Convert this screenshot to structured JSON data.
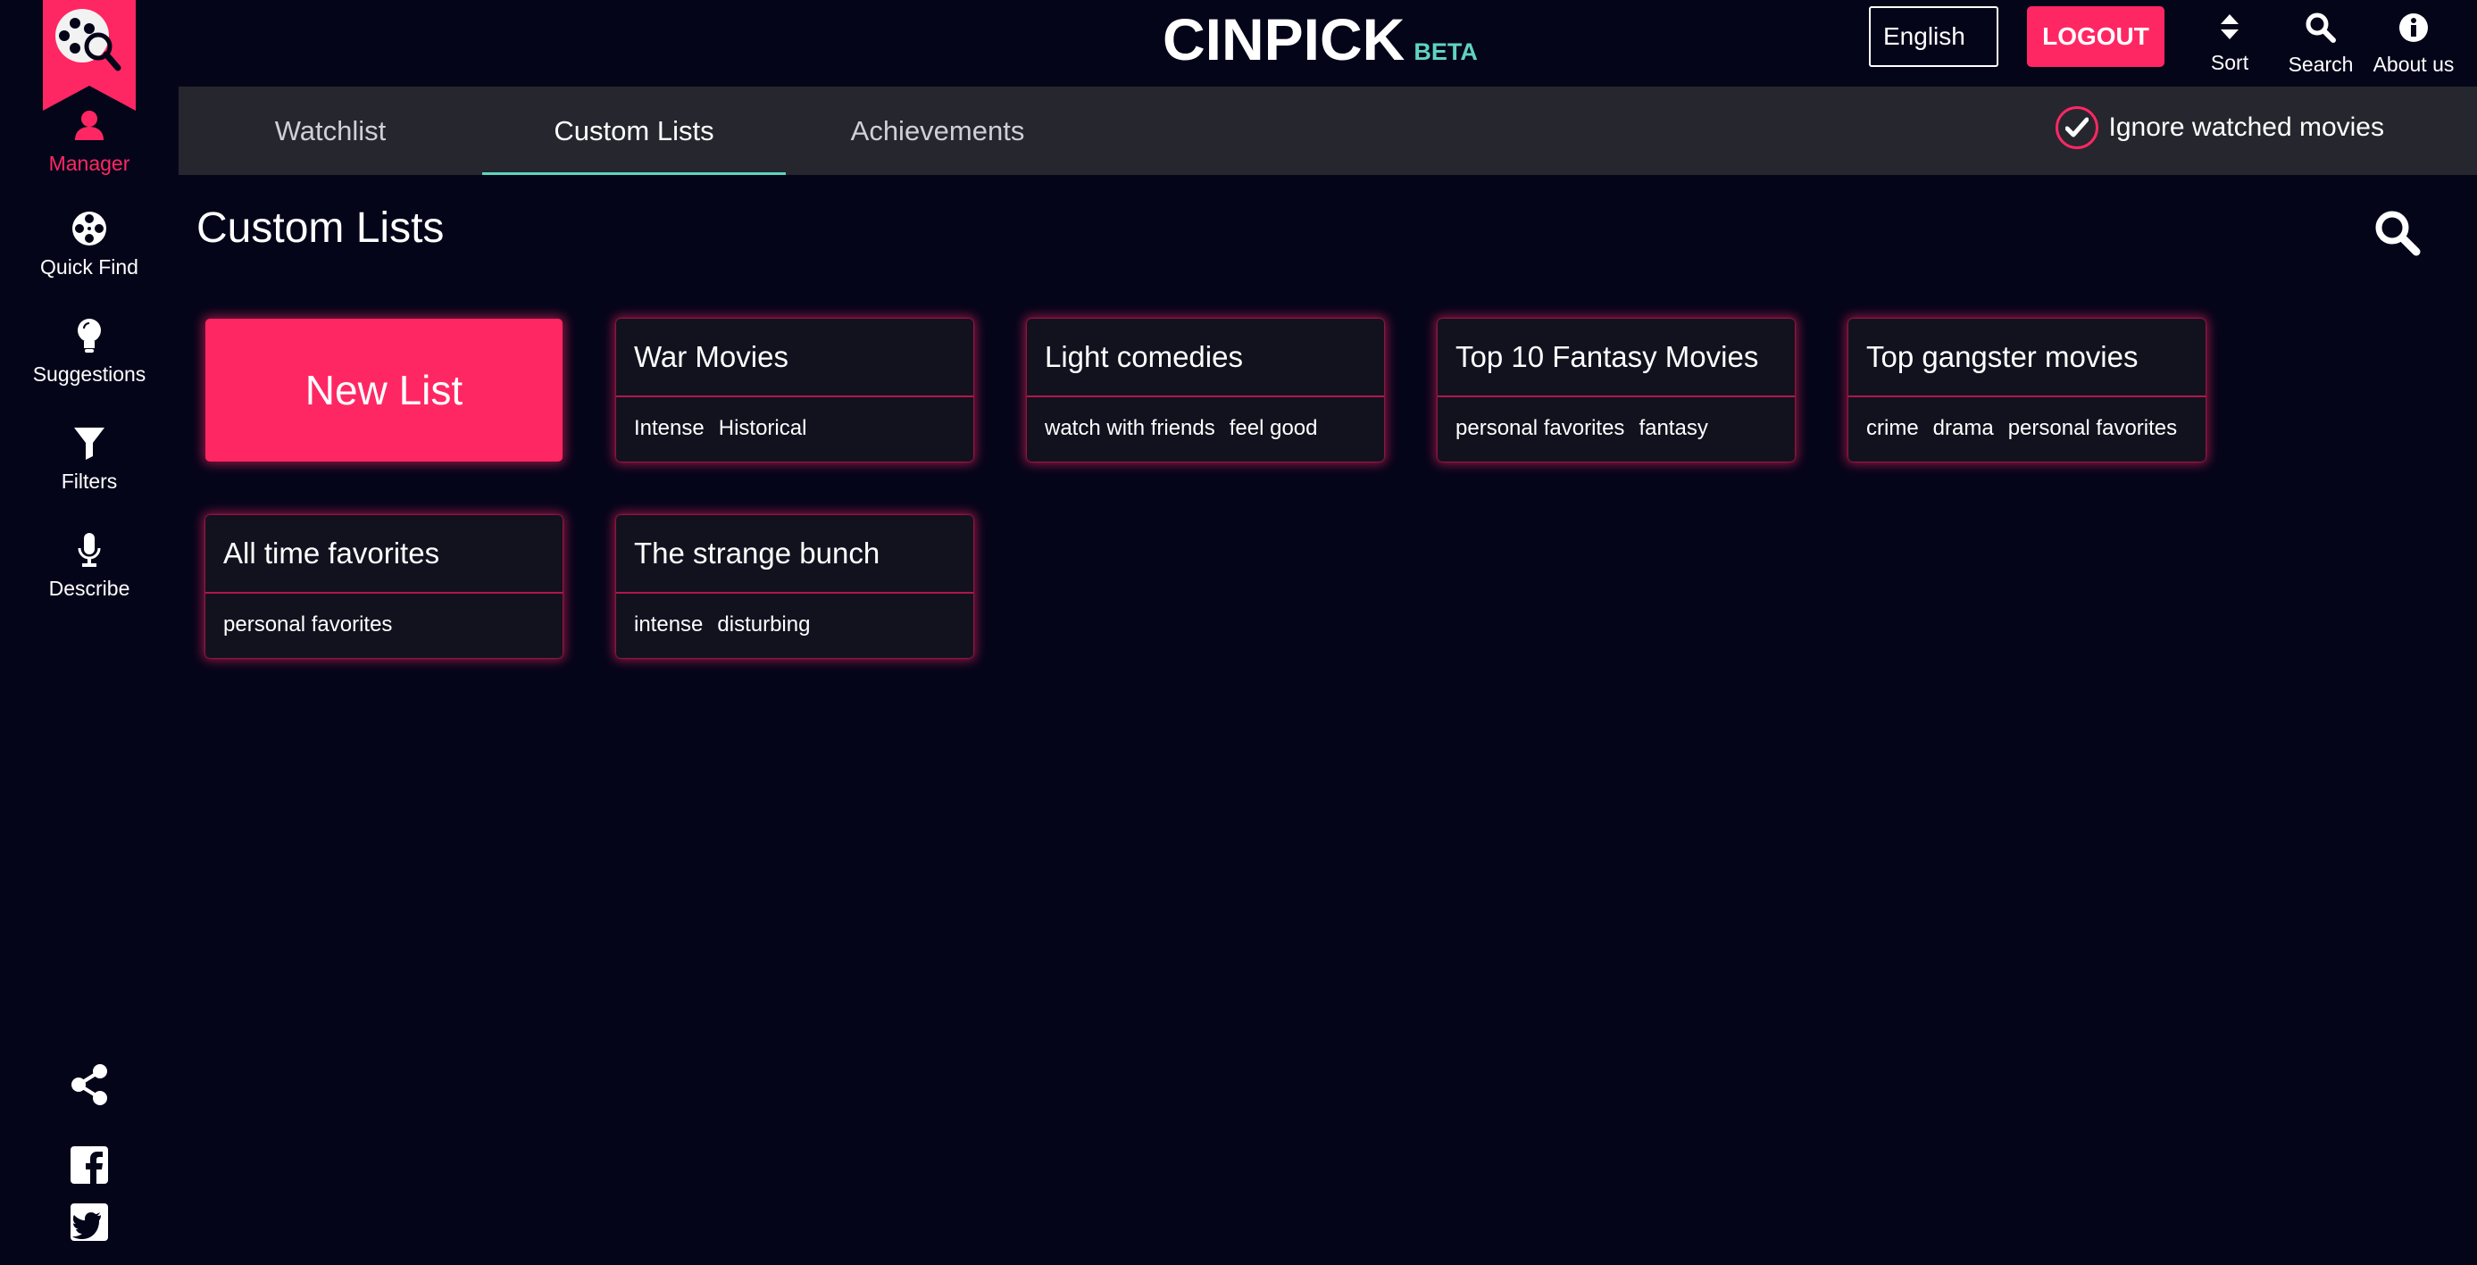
{
  "app": {
    "brand_name": "CINPICK",
    "brand_badge": "BETA"
  },
  "colors": {
    "background": "#05051a",
    "accent_pink": "#ff2763",
    "accent_teal": "#5fd3c0",
    "tabbar_bg": "#26262e",
    "card_bg": "#12121f"
  },
  "sidebar": {
    "items": [
      {
        "label": "Manager",
        "icon": "user-icon",
        "active": true
      },
      {
        "label": "Quick Find",
        "icon": "film-reel-icon",
        "active": false
      },
      {
        "label": "Suggestions",
        "icon": "lightbulb-icon",
        "active": false
      },
      {
        "label": "Filters",
        "icon": "filter-funnel-icon",
        "active": false
      },
      {
        "label": "Describe",
        "icon": "microphone-icon",
        "active": false
      }
    ],
    "social": [
      {
        "icon": "share-icon"
      },
      {
        "icon": "facebook-icon"
      },
      {
        "icon": "twitter-icon"
      }
    ]
  },
  "header": {
    "language": "English",
    "logout_label": "LOGOUT",
    "actions": [
      {
        "label": "Sort",
        "icon": "sort-icon"
      },
      {
        "label": "Search",
        "icon": "search-icon"
      },
      {
        "label": "About us",
        "icon": "info-icon"
      }
    ]
  },
  "tabs": [
    {
      "label": "Watchlist",
      "active": false
    },
    {
      "label": "Custom Lists",
      "active": true
    },
    {
      "label": "Achievements",
      "active": false
    }
  ],
  "ignore_watched": {
    "label": "Ignore watched movies",
    "checked": true
  },
  "main": {
    "title": "Custom Lists",
    "new_list_label": "New List",
    "lists": [
      {
        "title": "War Movies",
        "tags": [
          "Intense",
          "Historical"
        ]
      },
      {
        "title": "Light comedies",
        "tags": [
          "watch with friends",
          "feel good"
        ]
      },
      {
        "title": "Top 10 Fantasy Movies",
        "tags": [
          "personal favorites",
          "fantasy"
        ]
      },
      {
        "title": "Top gangster movies",
        "tags": [
          "crime",
          "drama",
          "personal favorites"
        ]
      },
      {
        "title": "All time favorites",
        "tags": [
          "personal favorites"
        ]
      },
      {
        "title": "The strange bunch",
        "tags": [
          "intense",
          "disturbing"
        ]
      }
    ]
  }
}
